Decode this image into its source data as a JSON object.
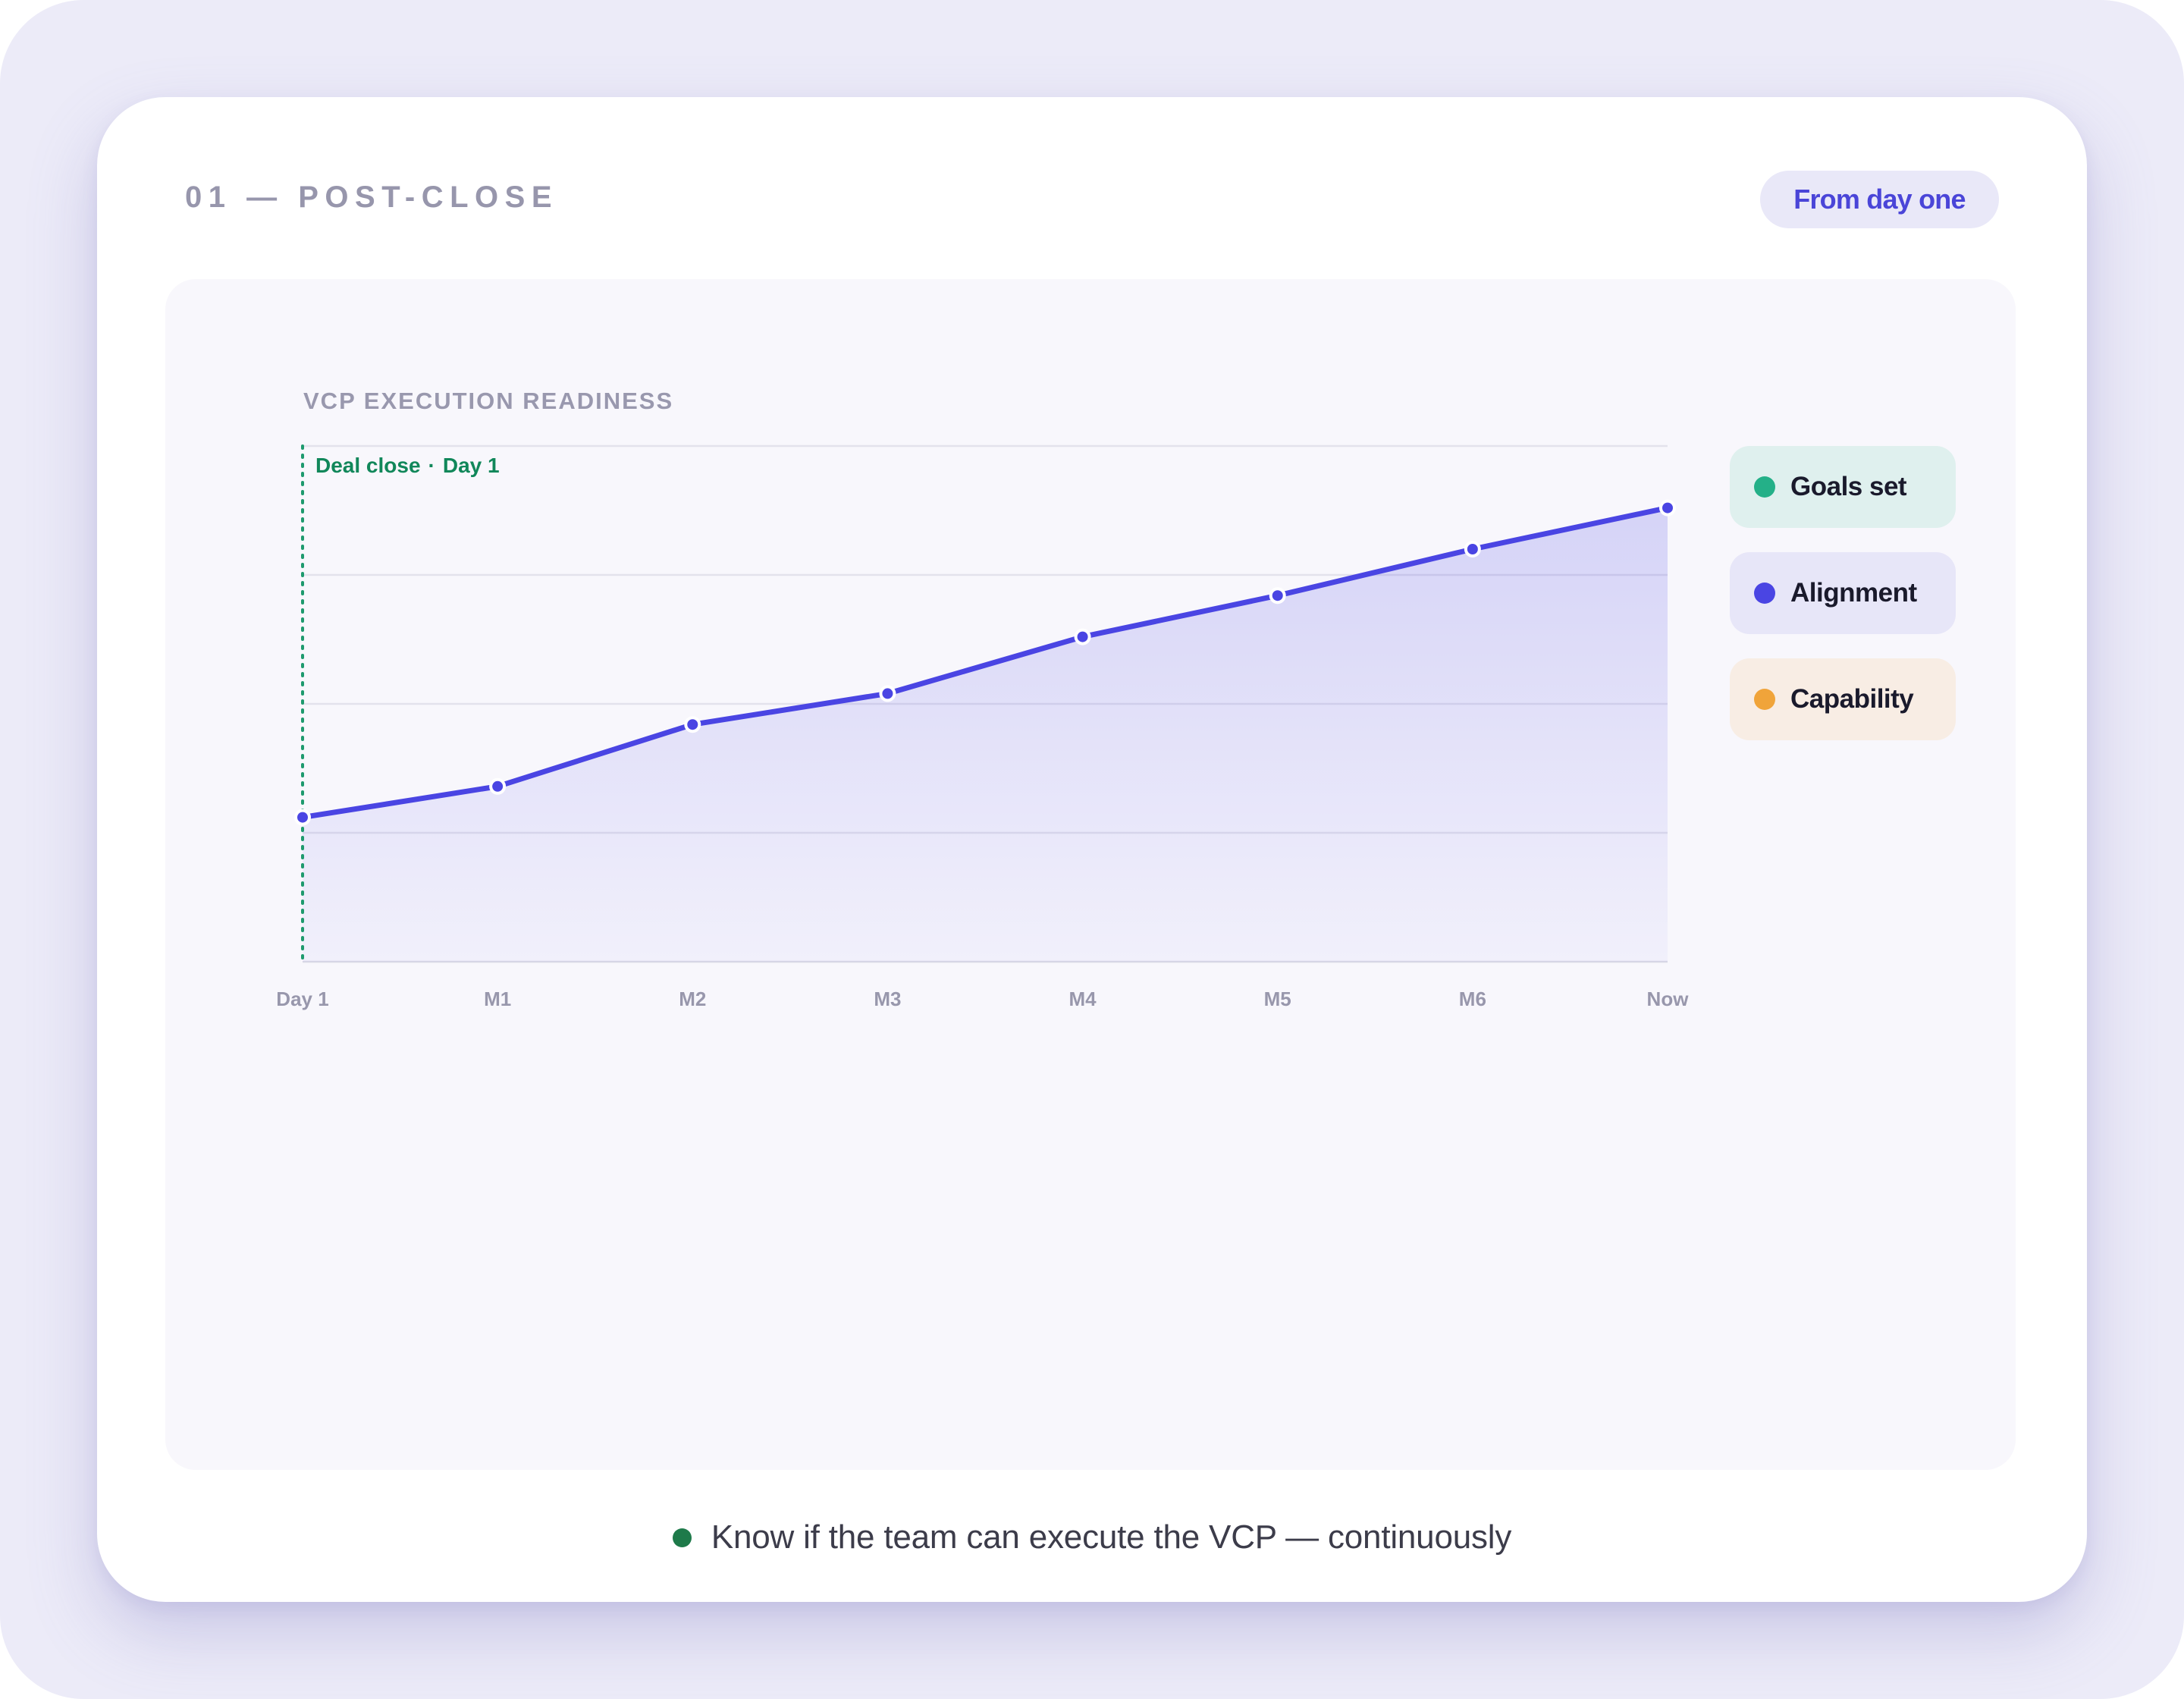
{
  "header": {
    "eyebrow": "01 — POST-CLOSE",
    "badge": "From day one"
  },
  "legend": [
    {
      "label": "Goals set",
      "color": "#24B088",
      "bg": "#DFF0EE"
    },
    {
      "label": "Alignment",
      "color": "#4A45E3",
      "bg": "#E7E6F8"
    },
    {
      "label": "Capability",
      "color": "#F0A43A",
      "bg": "#F8EDE4"
    }
  ],
  "caption": {
    "text": "Know if the team can execute the VCP — continuously",
    "dot_color": "#1E7A4A"
  },
  "colors": {
    "line": "#4A45E3",
    "marker": "#1E9A6E",
    "marker_text": "#11875A"
  },
  "chart_data": {
    "type": "area",
    "title": "VCP EXECUTION READINESS",
    "categories": [
      "Day 1",
      "M1",
      "M2",
      "M3",
      "M4",
      "M5",
      "M6",
      "Now"
    ],
    "series": [
      {
        "values": [
          28,
          34,
          46,
          52,
          63,
          71,
          80,
          88
        ]
      }
    ],
    "ylim": [
      0,
      100
    ],
    "grid": true,
    "y_tick_labels": false,
    "legend_position": "right",
    "annotation": {
      "at": "Day 1",
      "label_a": "Deal close",
      "separator": "·",
      "label_b": "Day 1"
    }
  }
}
